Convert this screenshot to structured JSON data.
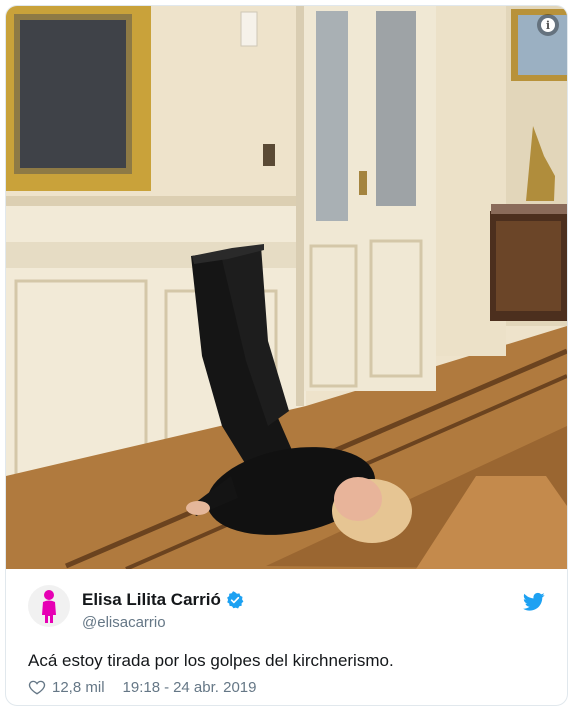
{
  "tweet": {
    "author_name": "Elisa Lilita Carrió",
    "handle": "@elisacarrio",
    "text": "Acá estoy tirada por los golpes del kirchnerismo.",
    "likes": "12,8 mil",
    "time": "19:18",
    "date": "24 abr. 2019",
    "verified": true
  },
  "icons": {
    "info": "info-icon",
    "verified": "verified-badge-icon",
    "bird": "twitter-bird-icon",
    "heart": "heart-icon"
  },
  "colors": {
    "brand": "#1da1f2",
    "text": "#14171a",
    "muted": "#657786",
    "avatar_figure": "#e600b4"
  }
}
